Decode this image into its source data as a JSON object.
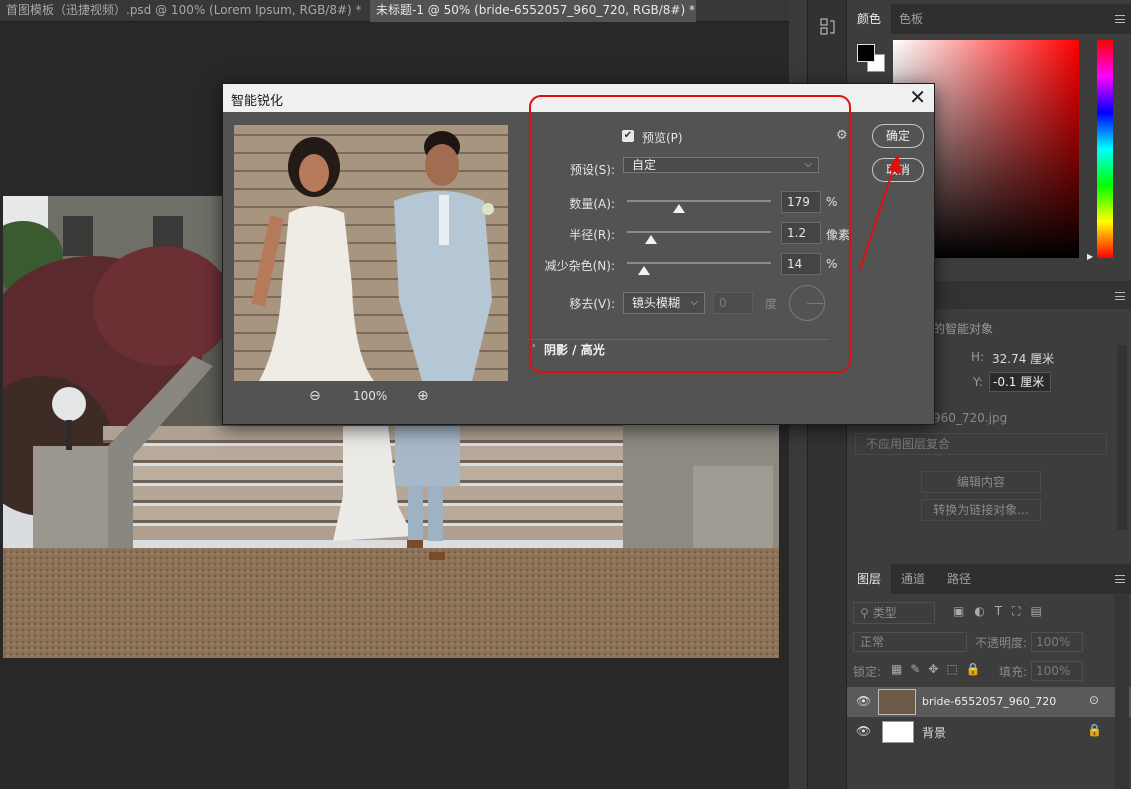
{
  "tabs": [
    {
      "label": "首图模板（迅捷视频）.psd @ 100% (Lorem Ipsum, RGB/8#) *",
      "close": "✖",
      "active": false
    },
    {
      "label": "未标题-1 @ 50% (bride-6552057_960_720, RGB/8#) *",
      "close": "✖",
      "active": true
    }
  ],
  "dialog": {
    "title": "智能锐化",
    "close": "✕",
    "preview_label": "预览(P)",
    "preset_label": "预设(S):",
    "preset_value": "自定",
    "amount_label": "数量(A):",
    "amount_value": "179",
    "amount_unit": "%",
    "amount_level": 0.36,
    "radius_label": "半径(R):",
    "radius_value": "1.2",
    "radius_unit": "像素",
    "radius_level": 0.17,
    "noise_label": "减少杂色(N):",
    "noise_value": "14",
    "noise_unit": "%",
    "noise_level": 0.12,
    "remove_label": "移去(V):",
    "remove_value": "镜头模糊",
    "angle_value": "0",
    "angle_unit": "度",
    "shadows_highlights": "阴影 / 高光",
    "ok": "确定",
    "cancel": "取消",
    "zoom": "100%"
  },
  "color_panel": {
    "tabs": [
      "颜色",
      "色板"
    ]
  },
  "properties": {
    "object_label": "的智能对象",
    "h_label": "H:",
    "h_value": "32.74 厘米",
    "y_label": "Y:",
    "y_value": "-0.1 厘米",
    "file": "960_720.jpg",
    "comp": "不应用图层复合",
    "edit": "编辑内容",
    "convert": "转换为链接对象..."
  },
  "layers_panel": {
    "tabs": [
      "图层",
      "通道",
      "路径"
    ],
    "filter": "类型",
    "blend": "正常",
    "opacity_label": "不透明度:",
    "opacity": "100%",
    "lock_label": "锁定:",
    "fill_label": "填充:",
    "fill": "100%",
    "layers": [
      {
        "name": "bride-6552057_960_720",
        "selected": true
      },
      {
        "name": "背景",
        "selected": false
      }
    ]
  },
  "colors": {
    "annotation": "#e01010",
    "panel": "#3d3d3d",
    "dialog": "#535353"
  }
}
